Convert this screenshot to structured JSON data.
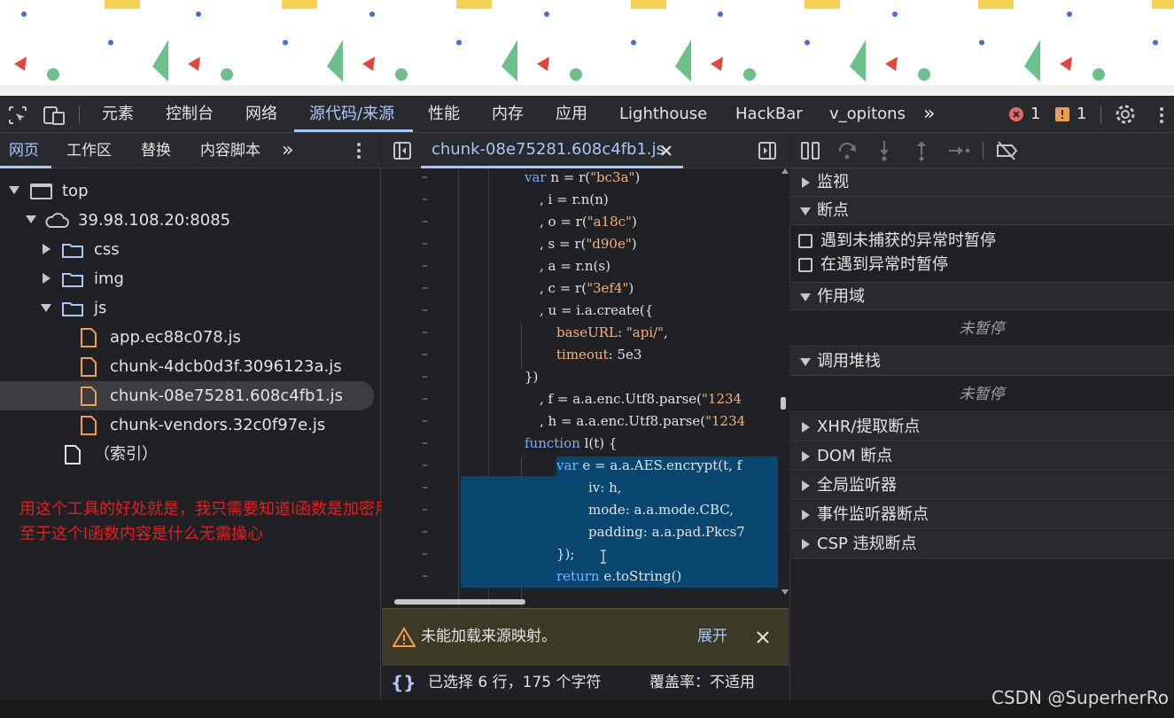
{
  "toolbar": {
    "tabs": [
      "元素",
      "控制台",
      "网络",
      "源代码/来源",
      "性能",
      "内存",
      "应用",
      "Lighthouse",
      "HackBar",
      "v_opitons"
    ],
    "more": "»",
    "error_count": "1",
    "warning_count": "1"
  },
  "left": {
    "tabs": [
      "网页",
      "工作区",
      "替换",
      "内容脚本"
    ],
    "more": "»",
    "tree": {
      "top": "top",
      "host": "39.98.108.20:8085",
      "css": "css",
      "img": "img",
      "js": "js",
      "files": [
        "app.ec88c078.js",
        "chunk-4dcb0d3f.3096123a.js",
        "chunk-08e75281.608c4fb1.js",
        "chunk-vendors.32c0f97e.js"
      ],
      "index": "（索引）"
    },
    "annotation": {
      "line1": "用这个工具的好处就是，我只需要知道l函数是加密用的就行，",
      "line2": "至于这个l函数内容是什么无需操心"
    }
  },
  "editor": {
    "tab_label": "chunk-08e75281.608c4fb1.js",
    "code": {
      "l1a": "var",
      "l1b": " n = r(",
      "l1c": "\"bc3a\"",
      "l1d": ")",
      "l2": ", i = r.n(n)",
      "l3a": ", o = r(",
      "l3b": "\"a18c\"",
      "l3c": ")",
      "l4a": ", s = r(",
      "l4b": "\"d90e\"",
      "l4c": ")",
      "l5": ", a = r.n(s)",
      "l6a": ", c = r(",
      "l6b": "\"3ef4\"",
      "l6c": ")",
      "l7": ", u = i.a.create({",
      "l8a": "baseURL",
      "l8b": ": ",
      "l8c": "\"api/\"",
      "l8d": ",",
      "l9a": "timeout",
      "l9b": ": 5e3",
      "l10": "})",
      "l11a": ", f = a.a.enc.Utf8.parse(",
      "l11b": "\"1234",
      "l12a": ", h = a.a.enc.Utf8.parse(",
      "l12b": "\"1234",
      "l13a": "function",
      "l13b": " l(t) {",
      "l14a": "var",
      "l14b": " e = a.a.AES.encrypt(t, f",
      "l15": "iv: h,",
      "l16": "mode: a.a.mode.CBC,",
      "l17": "padding: a.a.pad.Pkcs7",
      "l18": "});",
      "l19a": "return",
      "l19b": " e.toString()"
    },
    "gutter": "–",
    "warning": "未能加载来源映射。",
    "expand": "展开",
    "status_selection": "已选择 6 行，175 个字符",
    "status_coverage": "覆盖率：不适用"
  },
  "right": {
    "watch": "监视",
    "breakpoints": "断点",
    "bp_uncaught": "遇到未捕获的异常时暂停",
    "bp_caught": "在遇到异常时暂停",
    "scope": "作用域",
    "scope_status": "未暂停",
    "callstack": "调用堆栈",
    "callstack_status": "未暂停",
    "xhr": "XHR/提取断点",
    "dom": "DOM 断点",
    "global": "全局监听器",
    "event": "事件监听器断点",
    "csp": "CSP 违规断点"
  },
  "watermark": "CSDN @SuperherRo",
  "colors": {
    "accent": "#a8c7fa",
    "selection": "#094771",
    "warning_bg": "#3c3a26",
    "annotation": "#e02020"
  }
}
